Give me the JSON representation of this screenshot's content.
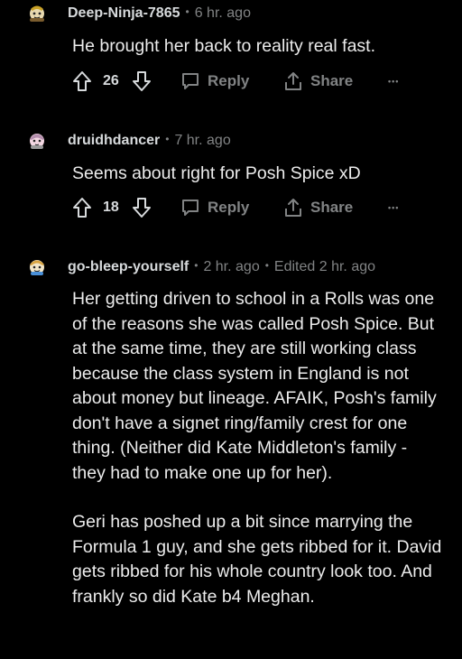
{
  "comments": [
    {
      "author": "Deep-Ninja-7865",
      "time": "6 hr. ago",
      "body": [
        "He brought her back to reality real fast."
      ],
      "votes": "26",
      "reply_label": "Reply",
      "share_label": "Share",
      "more_label": "•••"
    },
    {
      "author": "druidhdancer",
      "time": "7 hr. ago",
      "body": [
        "Seems about right for Posh Spice xD"
      ],
      "votes": "18",
      "reply_label": "Reply",
      "share_label": "Share",
      "more_label": "•••"
    },
    {
      "author": "go-bleep-yourself",
      "time": "2 hr. ago",
      "edited": "Edited 2 hr. ago",
      "body": [
        "Her getting driven to school in a Rolls was one of the reasons she was called Posh Spice. But at the same time, they are still working class because the class system in England is not about money but lineage. AFAIK, Posh's family don't have a signet ring/family crest for one thing. (Neither did Kate Middleton's family - they had to make one up for her).",
        "Geri has poshed up a bit since marrying the Formula 1 guy, and she gets ribbed for it. David gets ribbed for his whole country look too. And frankly so did Kate b4 Meghan."
      ]
    }
  ],
  "icons": {
    "upvote": "arrow-up-outline",
    "downvote": "arrow-down-outline",
    "reply": "speech-bubble-outline",
    "share": "share-tray-outline",
    "more": "horizontal-dots"
  },
  "colors": {
    "background": "#000000",
    "author": "#d7dadc",
    "meta": "#818384",
    "body": "#ececec",
    "action": "#818384"
  }
}
